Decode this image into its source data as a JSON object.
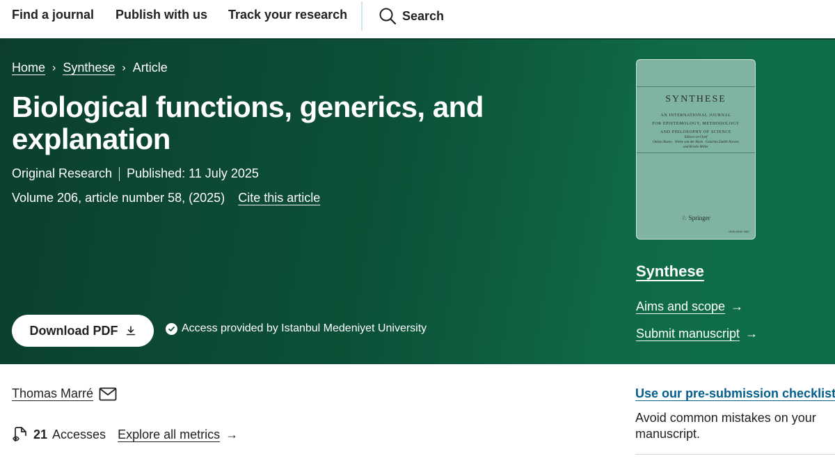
{
  "nav": {
    "items": [
      "Find a journal",
      "Publish with us",
      "Track your research"
    ],
    "search_label": "Search"
  },
  "breadcrumb": {
    "home": "Home",
    "journal": "Synthese",
    "current": "Article"
  },
  "article": {
    "title": "Biological functions, generics, and explanation",
    "type": "Original Research",
    "published": "Published: 11 July 2025",
    "volume_info": "Volume 206, article number 58, (2025)",
    "cite_label": "Cite this article",
    "download_label": "Download PDF",
    "access_text": "Access provided by Istanbul Medeniyet University"
  },
  "cover": {
    "title": "SYNTHESE",
    "subtitle_lines": [
      "AN INTERNATIONAL JOURNAL",
      "FOR EPISTEMOLOGY, METHODOLOGY",
      "AND PHILOSOPHY OF SCIENCE"
    ],
    "editors_lines": [
      "Editors-in-Chief",
      "Otávio Bueno · Wiebe van der Hoek · Catarina Dutilh Novaes",
      "and Kristie Miller"
    ],
    "publisher": "Springer",
    "issn": "ISSN 0039-7857"
  },
  "journal_sidebar": {
    "name": "Synthese",
    "aims_label": "Aims and scope",
    "submit_label": "Submit manuscript"
  },
  "author": {
    "name": "Thomas Marré"
  },
  "metrics": {
    "accesses_count": "21",
    "accesses_label": "Accesses",
    "explore_label": "Explore all metrics"
  },
  "presubmission": {
    "link": "Use our pre-submission checklist",
    "text": "Avoid common mistakes on your manuscript."
  },
  "colors": {
    "hero_dark": "#0b3f2c",
    "hero_light": "#0f6e4a",
    "link_blue": "#025e8d",
    "cover_bg": "#7fb3a2"
  }
}
